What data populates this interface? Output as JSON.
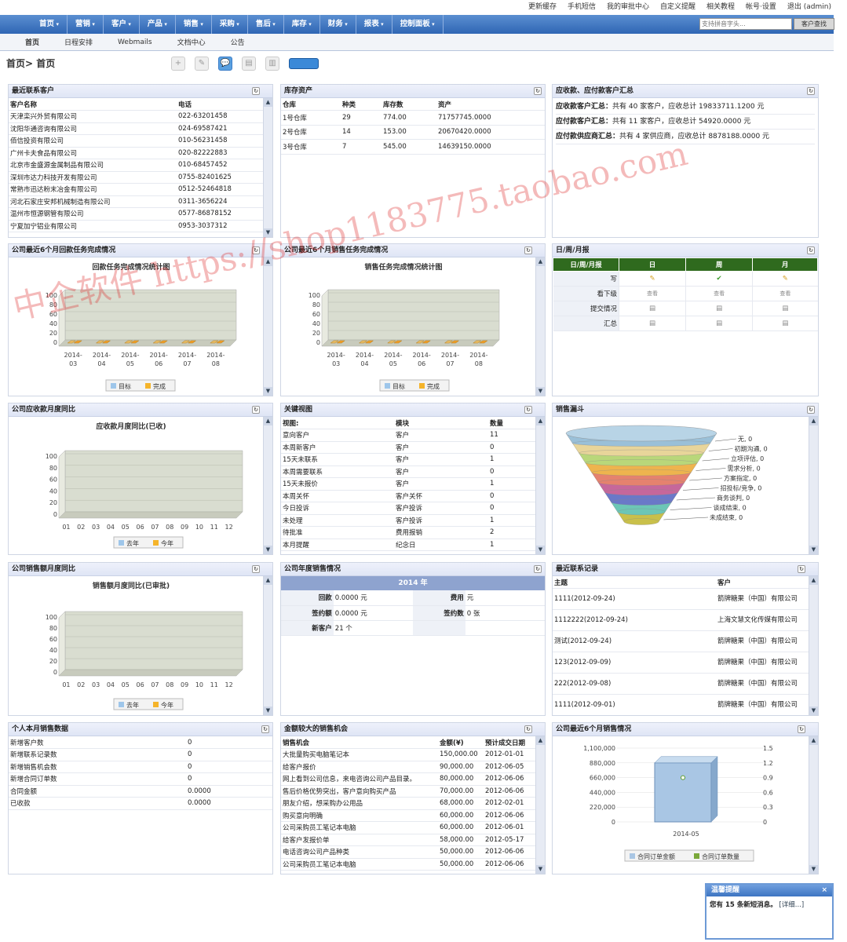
{
  "topbar": {
    "links": [
      "更新缓存",
      "手机短信",
      "我的审批中心",
      "自定义提醒",
      "相关教程",
      "帐号·设置",
      "退出 (admin)"
    ]
  },
  "mainnav": {
    "items": [
      "首页",
      "营销",
      "客户",
      "产品",
      "销售",
      "采购",
      "售后",
      "库存",
      "财务",
      "报表",
      "控制面板"
    ],
    "search_placeholder": "支持拼音字头...",
    "search_button": "客户查找"
  },
  "subnav": {
    "tabs": [
      "首页",
      "日程安排",
      "Webmails",
      "文档中心",
      "公告"
    ]
  },
  "breadcrumb": "首页> 首页",
  "recent_contacts": {
    "title": "最近联系客户",
    "headers": [
      "客户名称",
      "电话"
    ],
    "rows": [
      [
        "天津栾兴外贸有限公司",
        "022-63201458"
      ],
      [
        "沈阳华通咨询有限公司",
        "024-69587421"
      ],
      [
        "佰信投资有限公司",
        "010-56231458"
      ],
      [
        "广州卡夫食品有限公司",
        "020-82222883"
      ],
      [
        "北京市金盛源金属制品有限公司",
        "010-68457452"
      ],
      [
        "深圳市达力科技开发有限公司",
        "0755-82401625"
      ],
      [
        "常熟市迅达粉末冶金有限公司",
        "0512-52464818"
      ],
      [
        "河北石家庄安邦机械制造有限公司",
        "0311-3656224"
      ],
      [
        "温州市恒源钢管有限公司",
        "0577-86878152"
      ],
      [
        "宁夏加宁铝业有限公司",
        "0953-3037312"
      ]
    ]
  },
  "inventory": {
    "title": "库存资产",
    "headers": [
      "仓库",
      "种类",
      "库存数",
      "资产"
    ],
    "rows": [
      [
        "1号仓库",
        "29",
        "774.00",
        "71757745.0000"
      ],
      [
        "2号仓库",
        "14",
        "153.00",
        "20670420.0000"
      ],
      [
        "3号仓库",
        "7",
        "545.00",
        "14639150.0000"
      ]
    ]
  },
  "receivables": {
    "title": "应收款、应付款客户汇总",
    "lines": [
      {
        "label": "应收款客户汇总：",
        "text": "共有 40 家客户，应收总计 19833711.1200 元"
      },
      {
        "label": "应付款客户汇总：",
        "text": "共有 11 家客户，应收总计 54920.0000 元"
      },
      {
        "label": "应付款供应商汇总：",
        "text": "共有 4 家供应商，应收总计 8878188.0000 元"
      }
    ]
  },
  "payment_task": {
    "title": "公司最近6个月回款任务完成情况",
    "chart_title": "回款任务完成情况统计图",
    "legend": [
      "目标",
      "完成"
    ]
  },
  "sales_task": {
    "title": "公司最近6个月销售任务完成情况",
    "chart_title": "销售任务完成情况统计图",
    "legend": [
      "目标",
      "完成"
    ]
  },
  "daily": {
    "title": "日/周/月报",
    "headers": [
      "日/周/月报",
      "日",
      "周",
      "月"
    ],
    "rows": [
      "写",
      "看下级",
      "提交情况",
      "汇总"
    ],
    "view_text": "查看"
  },
  "receivable_yoy": {
    "title": "公司应收款月度同比",
    "chart_title": "应收款月度同比(已收)",
    "legend": [
      "去年",
      "今年"
    ]
  },
  "key_view": {
    "title": "关键视图",
    "headers": [
      "视图:",
      "模块",
      "数量"
    ],
    "rows": [
      [
        "意向客户",
        "客户",
        "11"
      ],
      [
        "本周新客户",
        "客户",
        "0"
      ],
      [
        "15天未联系",
        "客户",
        "1"
      ],
      [
        "本周需要联系",
        "客户",
        "0"
      ],
      [
        "15天未报价",
        "客户",
        "1"
      ],
      [
        "本周关怀",
        "客户关怀",
        "0"
      ],
      [
        "今日投诉",
        "客户投诉",
        "0"
      ],
      [
        "未处理",
        "客户投诉",
        "1"
      ],
      [
        "待批准",
        "费用报销",
        "2"
      ],
      [
        "本月提醒",
        "纪念日",
        "1"
      ]
    ]
  },
  "funnel": {
    "title": "销售漏斗",
    "stages": [
      "无, 0",
      "初期沟通, 0",
      "立项评估, 0",
      "需求分析, 0",
      "方案指定, 0",
      "招投标/竞争, 0",
      "商务谈判, 0",
      "谈成结束, 0",
      "未成结束, 0"
    ],
    "colors": [
      "#9ac0d8",
      "#e8d59a",
      "#b9d77a",
      "#eeb44e",
      "#e5826e",
      "#c6679b",
      "#6a78c8",
      "#6cc6b6",
      "#c9c04a"
    ]
  },
  "sales_yoy": {
    "title": "公司销售额月度同比",
    "chart_title": "销售额月度同比(已审批)",
    "legend": [
      "去年",
      "今年"
    ]
  },
  "annual": {
    "title": "公司年度销售情况",
    "year": "2014 年",
    "rows": [
      [
        "回款",
        "0.0000 元",
        "费用",
        "元"
      ],
      [
        "签约额",
        "0.0000 元",
        "签约数",
        "0 张"
      ],
      [
        "新客户",
        "21 个",
        "",
        ""
      ]
    ]
  },
  "recent_records": {
    "title": "最近联系记录",
    "headers": [
      "主题",
      "客户"
    ],
    "rows": [
      [
        "1111(2012-09-24)",
        "箭牌糖果（中国）有限公司"
      ],
      [
        "1112222(2012-09-24)",
        "上海文慧文化传媒有限公司"
      ],
      [
        "测试(2012-09-24)",
        "箭牌糖果（中国）有限公司"
      ],
      [
        "123(2012-09-09)",
        "箭牌糖果（中国）有限公司"
      ],
      [
        "222(2012-09-08)",
        "箭牌糖果（中国）有限公司"
      ],
      [
        "1111(2012-09-01)",
        "箭牌糖果（中国）有限公司"
      ]
    ]
  },
  "personal": {
    "title": "个人本月销售数据",
    "rows": [
      [
        "新增客户数",
        "0"
      ],
      [
        "新增联系记录数",
        "0"
      ],
      [
        "新增销售机会数",
        "0"
      ],
      [
        "新增合同订单数",
        "0"
      ],
      [
        "合同金额",
        "0.0000"
      ],
      [
        "已收款",
        "0.0000"
      ]
    ]
  },
  "big_opps": {
    "title": "金额较大的销售机会",
    "headers": [
      "销售机会",
      "金额(¥)",
      "预计成交日期"
    ],
    "rows": [
      [
        "大批量购买电脑笔记本",
        "150,000.00",
        "2012-01-01"
      ],
      [
        "给客户报价",
        "90,000.00",
        "2012-06-05"
      ],
      [
        "网上看到公司信息，来电咨询公司产品目录。",
        "80,000.00",
        "2012-06-06"
      ],
      [
        "售后价格优势突出，客户意向购买产品",
        "70,000.00",
        "2012-06-06"
      ],
      [
        "朋友介绍，想采购办公用品",
        "68,000.00",
        "2012-02-01"
      ],
      [
        "购买意向明确",
        "60,000.00",
        "2012-06-06"
      ],
      [
        "公司采购员工笔记本电脑",
        "60,000.00",
        "2012-06-01"
      ],
      [
        "给客户发报价单",
        "58,000.00",
        "2012-05-17"
      ],
      [
        "电话咨询公司产品种类",
        "50,000.00",
        "2012-06-06"
      ],
      [
        "公司采购员工笔记本电脑",
        "50,000.00",
        "2012-06-06"
      ]
    ]
  },
  "recent_sales": {
    "title": "公司最近6个月销售情况",
    "legend": [
      "合同订单金额",
      "合同订单数量"
    ]
  },
  "notice": {
    "title": "温馨提醒",
    "message": "您有 15 条新短消息。",
    "link": "[详细...]"
  },
  "watermark": "中企软件 https://shop1183775.taobao.com",
  "chart_data": [
    {
      "type": "bar",
      "title": "回款任务完成情况统计图",
      "categories": [
        "2014-03",
        "2014-04",
        "2014-05",
        "2014-06",
        "2014-07",
        "2014-08"
      ],
      "series": [
        {
          "name": "目标",
          "values": [
            0,
            0,
            0,
            0,
            0,
            0
          ]
        },
        {
          "name": "完成",
          "values": [
            0,
            0,
            0,
            0,
            0,
            0
          ]
        }
      ],
      "ylim": [
        0,
        100
      ],
      "yticks": [
        0,
        20,
        40,
        60,
        80,
        100
      ]
    },
    {
      "type": "bar",
      "title": "销售任务完成情况统计图",
      "categories": [
        "2014-03",
        "2014-04",
        "2014-05",
        "2014-06",
        "2014-07",
        "2014-08"
      ],
      "series": [
        {
          "name": "目标",
          "values": [
            0,
            0,
            0,
            0,
            0,
            0
          ]
        },
        {
          "name": "完成",
          "values": [
            0,
            0,
            0,
            0,
            0,
            0
          ]
        }
      ],
      "ylim": [
        0,
        100
      ],
      "yticks": [
        0,
        20,
        40,
        60,
        80,
        100
      ]
    },
    {
      "type": "bar",
      "title": "应收款月度同比(已收)",
      "categories": [
        "01",
        "02",
        "03",
        "04",
        "05",
        "06",
        "07",
        "08",
        "09",
        "10",
        "11",
        "12"
      ],
      "series": [
        {
          "name": "去年",
          "values": [
            0,
            0,
            0,
            0,
            0,
            0,
            0,
            0,
            0,
            0,
            0,
            0
          ]
        },
        {
          "name": "今年",
          "values": [
            0,
            0,
            0,
            0,
            0,
            0,
            0,
            0,
            0,
            0,
            0,
            0
          ]
        }
      ],
      "ylim": [
        0,
        100
      ],
      "yticks": [
        0,
        20,
        40,
        60,
        80,
        100
      ]
    },
    {
      "type": "bar",
      "title": "销售额月度同比(已审批)",
      "categories": [
        "01",
        "02",
        "03",
        "04",
        "05",
        "06",
        "07",
        "08",
        "09",
        "10",
        "11",
        "12"
      ],
      "series": [
        {
          "name": "去年",
          "values": [
            0,
            0,
            0,
            0,
            0,
            0,
            0,
            0,
            0,
            0,
            0,
            0
          ]
        },
        {
          "name": "今年",
          "values": [
            0,
            0,
            0,
            0,
            0,
            0,
            0,
            0,
            0,
            0,
            0,
            0
          ]
        }
      ],
      "ylim": [
        0,
        100
      ],
      "yticks": [
        0,
        20,
        40,
        60,
        80,
        100
      ]
    },
    {
      "type": "bar",
      "categories": [
        "2014-05"
      ],
      "series": [
        {
          "name": "合同订单金额",
          "values": [
            880000
          ]
        },
        {
          "name": "合同订单数量",
          "values": [
            0.9
          ]
        }
      ],
      "ylim": [
        0,
        1100000
      ],
      "yticks": [
        "0",
        "220,000",
        "440,000",
        "660,000",
        "880,000",
        "1,100,000"
      ],
      "y2lim": [
        0,
        1.5
      ],
      "y2ticks": [
        "0",
        "0.3",
        "0.6",
        "0.9",
        "1.2",
        "1.5"
      ]
    }
  ]
}
